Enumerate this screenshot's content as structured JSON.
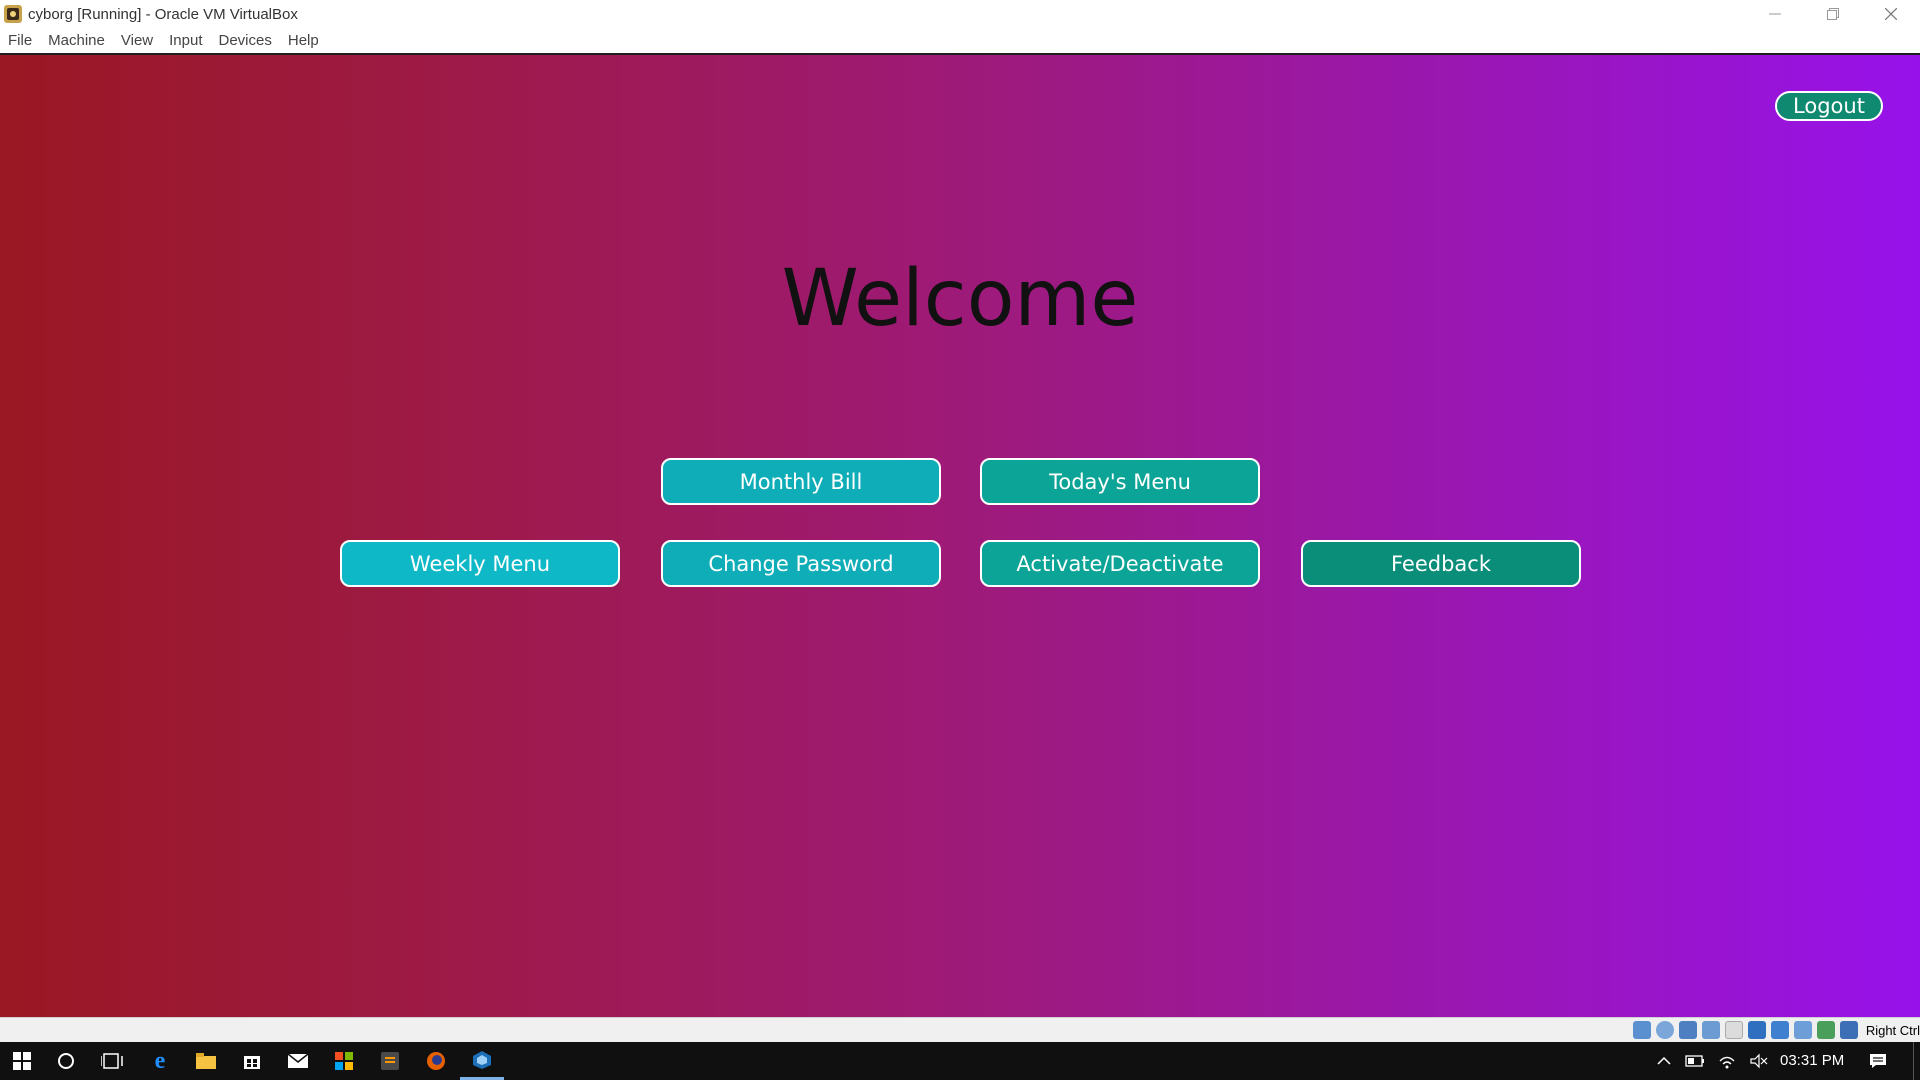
{
  "window": {
    "title": "cyborg [Running] - Oracle VM VirtualBox",
    "menu": [
      "File",
      "Machine",
      "View",
      "Input",
      "Devices",
      "Help"
    ],
    "controls": [
      "minimize-icon",
      "restore-icon",
      "close-icon"
    ]
  },
  "app": {
    "logout_label": "Logout",
    "welcome_text": "Welcome",
    "buttons": {
      "monthly_bill": "Monthly Bill",
      "todays_menu": "Today's Menu",
      "weekly_menu": "Weekly Menu",
      "change_password": "Change Password",
      "activate_deactivate": "Activate/Deactivate",
      "feedback": "Feedback"
    },
    "colors": {
      "gradient_left": "#9a1823",
      "gradient_right": "#9712ea",
      "button_teal_light": "#0fb3c0",
      "button_teal_dark": "#0a8e7a",
      "logout_green": "#0f8a70"
    }
  },
  "statusbar": {
    "icons": [
      "hard-disk-icon",
      "optical-drive-icon",
      "audio-icon",
      "network-icon",
      "usb-icon",
      "shared-folders-icon",
      "display-icon",
      "video-capture-icon",
      "cpu-icon",
      "mouse-integration-icon",
      "keyboard-icon"
    ],
    "host_key": "Right Ctrl"
  },
  "taskbar": {
    "items": [
      "start-icon",
      "cortana-icon",
      "task-view-icon",
      "edge-icon",
      "file-explorer-icon",
      "store-icon",
      "mail-icon",
      "app-icon",
      "sublime-icon",
      "firefox-icon",
      "virtualbox-icon"
    ],
    "tray_icons": [
      "chevron-up-icon",
      "battery-icon",
      "wifi-icon",
      "volume-muted-icon"
    ],
    "clock": "03:31 PM",
    "notification_icon": "action-center-icon"
  }
}
